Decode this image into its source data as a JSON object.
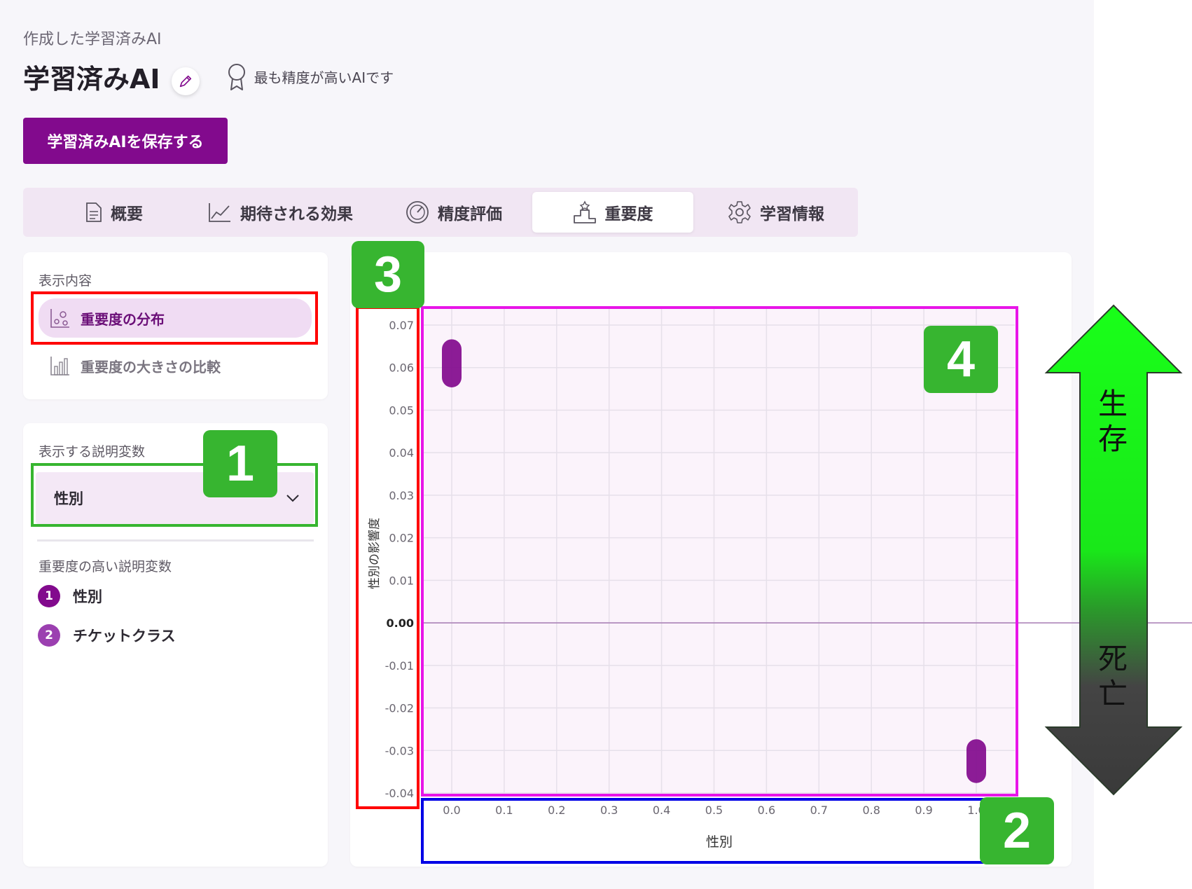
{
  "breadcrumb": "作成した学習済みAI",
  "page_title": "学習済みAI",
  "award_text": "最も精度が高いAIです",
  "save_button": "学習済みAIを保存する",
  "tabs": [
    {
      "label": "概要",
      "icon": "document-icon",
      "active": false
    },
    {
      "label": "期待される効果",
      "icon": "line-chart-icon",
      "active": false
    },
    {
      "label": "精度評価",
      "icon": "gauge-icon",
      "active": false
    },
    {
      "label": "重要度",
      "icon": "podium-icon",
      "active": true
    },
    {
      "label": "学習情報",
      "icon": "gear-icon",
      "active": false
    }
  ],
  "display_content": {
    "label": "表示内容",
    "items": [
      {
        "label": "重要度の分布",
        "icon": "scatter-icon",
        "active": true
      },
      {
        "label": "重要度の大きさの比較",
        "icon": "bar-chart-icon",
        "active": false
      }
    ]
  },
  "variable_select": {
    "label": "表示する説明変数",
    "value": "性別"
  },
  "top_variables": {
    "label": "重要度の高い説明変数",
    "items": [
      {
        "rank": "1",
        "label": "性別"
      },
      {
        "rank": "2",
        "label": "チケットクラス"
      }
    ]
  },
  "annotations": {
    "badges": [
      "1",
      "2",
      "3",
      "4"
    ],
    "arrow_up_label": "生存",
    "arrow_down_label": "死亡"
  },
  "colors": {
    "accent": "#820a8d",
    "rank2": "#9b3fb0",
    "annotation_green": "#37b530",
    "box_red": "#ff0000",
    "box_blue": "#0000e6",
    "box_magenta": "#e815e8"
  },
  "chart_data": {
    "type": "scatter",
    "xlabel": "性別",
    "ylabel": "性別の影響度",
    "x_ticks": [
      "0.0",
      "0.1",
      "0.2",
      "0.3",
      "0.4",
      "0.5",
      "0.6",
      "0.7",
      "0.8",
      "0.9",
      "1.0"
    ],
    "y_ticks": [
      "0.07",
      "0.06",
      "0.05",
      "0.04",
      "0.03",
      "0.02",
      "0.01",
      "0.00",
      "-0.01",
      "-0.02",
      "-0.03",
      "-0.04"
    ],
    "xlim": [
      0.0,
      1.0
    ],
    "ylim": [
      -0.04,
      0.07
    ],
    "grid": true,
    "series": [
      {
        "points": [
          {
            "x": 0.0,
            "y_low": 0.057,
            "y_high": 0.065
          },
          {
            "x": 1.0,
            "y_low": -0.036,
            "y_high": -0.029
          }
        ]
      }
    ]
  }
}
